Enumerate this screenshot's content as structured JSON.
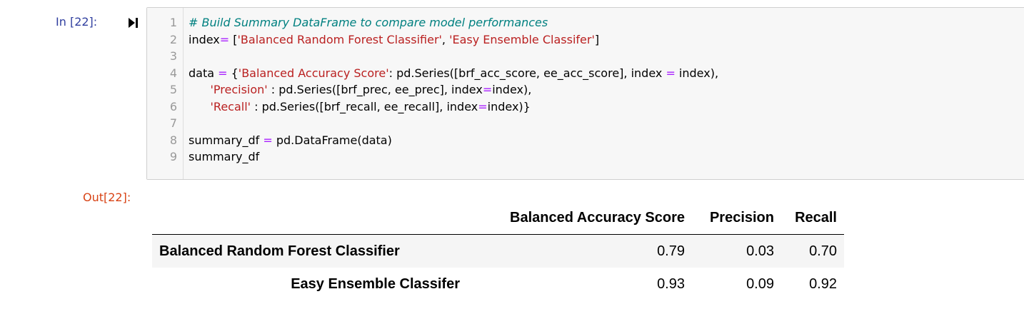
{
  "cell": {
    "in_prompt": "In [22]:",
    "out_prompt": "Out[22]:",
    "run_icon": "step-forward-icon",
    "code_lines": [
      {
        "n": "1",
        "tokens": [
          {
            "t": "# Build Summary DataFrame to compare model performances",
            "c": "cm"
          }
        ]
      },
      {
        "n": "2",
        "tokens": [
          {
            "t": "index",
            "c": ""
          },
          {
            "t": "=",
            "c": "op"
          },
          {
            "t": " [",
            "c": ""
          },
          {
            "t": "'Balanced Random Forest Classifier'",
            "c": "str"
          },
          {
            "t": ", ",
            "c": ""
          },
          {
            "t": "'Easy Ensemble Classifer'",
            "c": "str"
          },
          {
            "t": "]",
            "c": ""
          }
        ]
      },
      {
        "n": "3",
        "tokens": []
      },
      {
        "n": "4",
        "tokens": [
          {
            "t": "data ",
            "c": ""
          },
          {
            "t": "=",
            "c": "op"
          },
          {
            "t": " {",
            "c": ""
          },
          {
            "t": "'Balanced Accuracy Score'",
            "c": "str"
          },
          {
            "t": ": pd.Series([brf_acc_score, ee_acc_score], index ",
            "c": ""
          },
          {
            "t": "=",
            "c": "op"
          },
          {
            "t": " index),",
            "c": ""
          }
        ]
      },
      {
        "n": "5",
        "tokens": [
          {
            "t": "      ",
            "c": ""
          },
          {
            "t": "'Precision'",
            "c": "str"
          },
          {
            "t": " : pd.Series([brf_prec, ee_prec], index",
            "c": ""
          },
          {
            "t": "=",
            "c": "op"
          },
          {
            "t": "index),",
            "c": ""
          }
        ]
      },
      {
        "n": "6",
        "tokens": [
          {
            "t": "      ",
            "c": ""
          },
          {
            "t": "'Recall'",
            "c": "str"
          },
          {
            "t": " : pd.Series([brf_recall, ee_recall], index",
            "c": ""
          },
          {
            "t": "=",
            "c": "op"
          },
          {
            "t": "index)}",
            "c": ""
          }
        ]
      },
      {
        "n": "7",
        "tokens": []
      },
      {
        "n": "8",
        "tokens": [
          {
            "t": "summary_df ",
            "c": ""
          },
          {
            "t": "=",
            "c": "op"
          },
          {
            "t": " pd.DataFrame(data)",
            "c": ""
          }
        ]
      },
      {
        "n": "9",
        "tokens": [
          {
            "t": "summary_df",
            "c": ""
          }
        ]
      }
    ]
  },
  "output": {
    "columns": [
      "",
      "Balanced Accuracy Score",
      "Precision",
      "Recall"
    ],
    "rows": [
      {
        "index": "Balanced Random Forest Classifier",
        "values": [
          "0.79",
          "0.03",
          "0.70"
        ]
      },
      {
        "index": "Easy Ensemble Classifer",
        "values": [
          "0.93",
          "0.09",
          "0.92"
        ]
      }
    ]
  },
  "colors": {
    "in_prompt": "#303f9f",
    "out_prompt": "#d84315",
    "comment": "#008080",
    "string": "#ba2121",
    "operator": "#aa22ff",
    "cell_background": "#f7f7f7"
  }
}
